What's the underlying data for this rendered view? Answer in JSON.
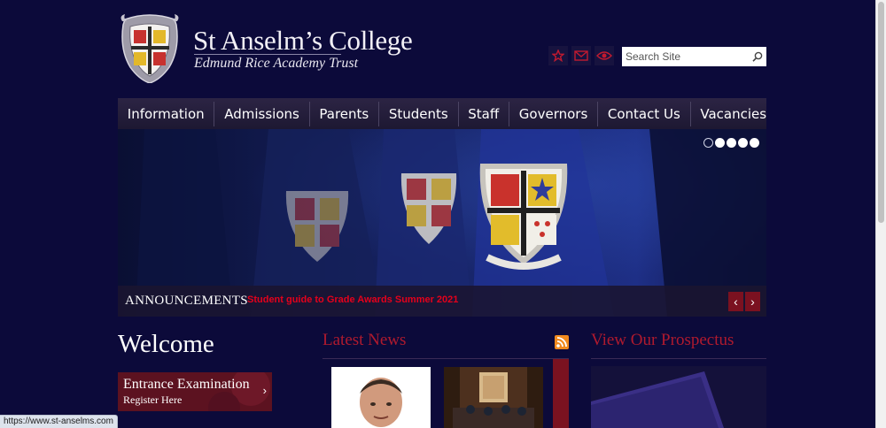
{
  "header": {
    "title": "St Anselm’s College",
    "subtitle": "Edmund Rice Academy Trust"
  },
  "social": [
    {
      "name": "favourite",
      "icon": "star-icon"
    },
    {
      "name": "email",
      "icon": "envelope-icon"
    },
    {
      "name": "view",
      "icon": "eye-icon"
    }
  ],
  "search": {
    "placeholder": "Search Site",
    "value": ""
  },
  "nav": {
    "items": [
      "Information",
      "Admissions",
      "Parents",
      "Students",
      "Staff",
      "Governors",
      "Contact Us",
      "Vacancies"
    ]
  },
  "slider": {
    "slides": 5,
    "active_index": 0,
    "announcements_label": "ANNOUNCEMENTS",
    "announcement_text": "Student guide to Grade Awards Summer 2021"
  },
  "welcome": {
    "heading": "Welcome",
    "entrance_title": "Entrance Examination",
    "entrance_sub": "Register Here"
  },
  "news": {
    "heading": "Latest News"
  },
  "prospectus": {
    "heading": "View Our Prospectus"
  },
  "status_bar": {
    "url": "https://www.st-anselms.com"
  },
  "colors": {
    "background": "#0c0a3a",
    "accent_red": "#b01a2e",
    "announcement_red": "#e5001b",
    "nav_bg": "#241e3b"
  }
}
